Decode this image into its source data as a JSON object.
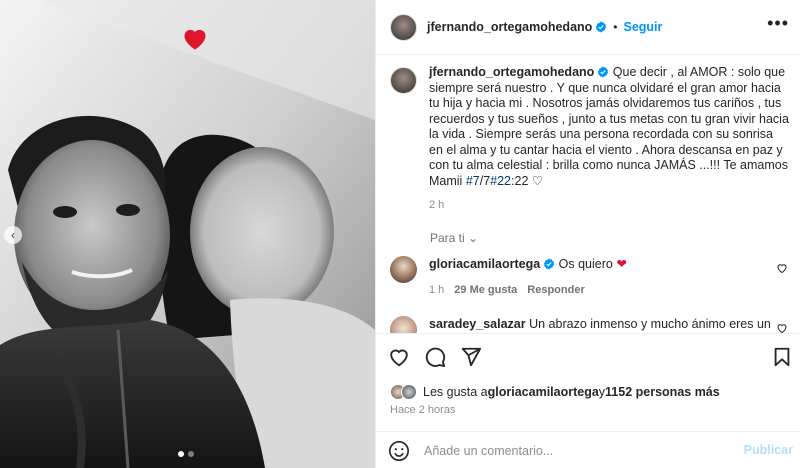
{
  "post": {
    "author": "jfernando_ortegamohedano",
    "follow_label": "Seguir",
    "dot": "•",
    "more_label": "•••"
  },
  "media": {
    "hearts": [
      "heart",
      "heart",
      "heart",
      "heart",
      "heart",
      "heart"
    ],
    "heart_color": "#e0142b",
    "carousel_count": 2,
    "carousel_active": 0
  },
  "caption": {
    "author": "jfernando_ortegamohedano",
    "text_before": " Que decir , al AMOR : solo que siempre será nuestro . Y que nunca olvidaré el gran amor hacia tu hija y hacia mi . Nosotros jamás olvidaremos tus cariños , tus recuerdos y tus sueños , junto a tus metas con tu gran vivir hacia la vida . Siempre serás una persona recordada con su sonrisa en el alma y tu cantar hacia el viento . Ahora descansa en paz y con tu alma celestial : brilla como nunca JAMÁS ...!!! Te amamos Mamii ",
    "hashtag1": "#7",
    "sep": "/7",
    "hashtag2": "#22",
    "text_after": ":22 ",
    "heart_glyph": "♡",
    "time": "2 h"
  },
  "sort": {
    "label": "Para ti",
    "chevron": "⌄"
  },
  "comments": [
    {
      "user": "gloriacamilaortega",
      "text": "Os quiero ",
      "emoji": "❤",
      "time": "1 h",
      "likes": "29 Me gusta",
      "reply": "Responder"
    },
    {
      "user": "saradey_salazar",
      "text": "Un abrazo inmenso y mucho ánimo eres un"
    }
  ],
  "likes": {
    "prefix": "Les gusta a ",
    "user": "gloriacamilaortega",
    "middle": " y ",
    "count": "1152 personas más"
  },
  "posted": "Hace 2 horas",
  "comment_box": {
    "placeholder": "Añade un comentario...",
    "publish_label": "Publicar"
  },
  "colors": {
    "link": "#0095f6",
    "hashtag": "#00376b",
    "verified": "#0095f6"
  }
}
